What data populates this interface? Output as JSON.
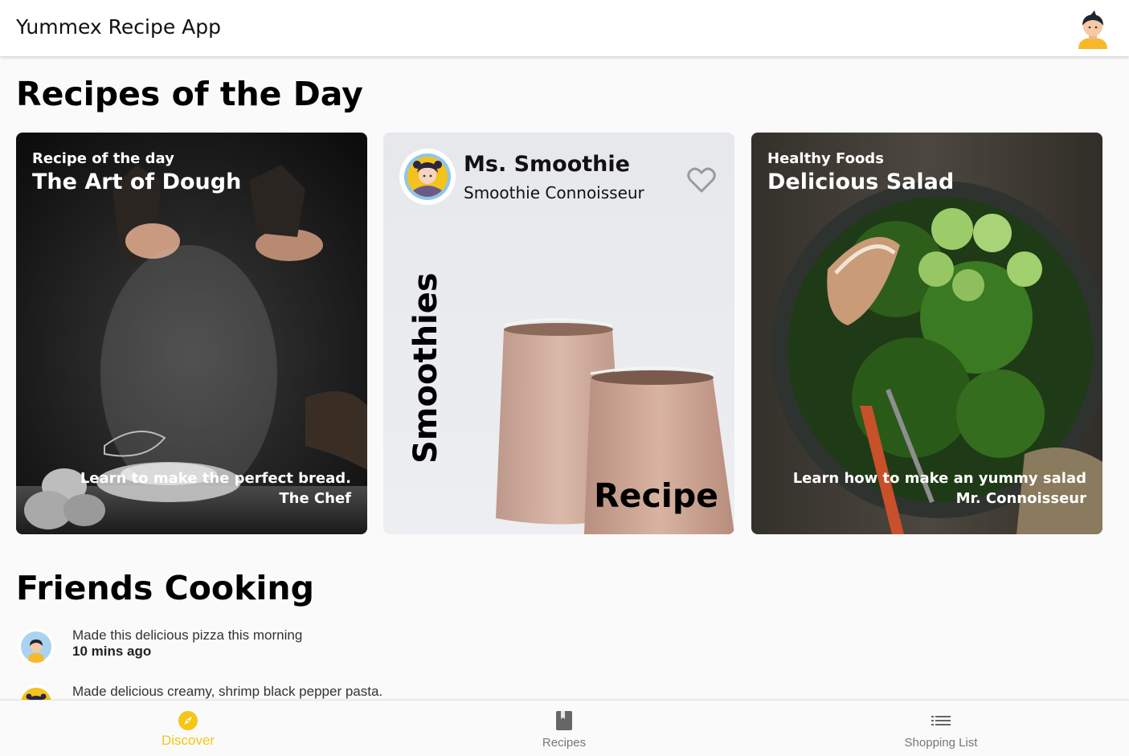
{
  "app": {
    "title": "Yummex Recipe App"
  },
  "sections": {
    "recipes_title": "Recipes of the Day",
    "friends_title": "Friends Cooking"
  },
  "cards": [
    {
      "subtitle": "Recipe of the day",
      "title": "The Art of Dough",
      "description": "Learn to make the perfect bread.",
      "author": "The Chef"
    },
    {
      "chef_name": "Ms. Smoothie",
      "chef_role": "Smoothie Connoisseur",
      "vertical_label": "Smoothies",
      "corner_label": "Recipe",
      "favorited": false
    },
    {
      "subtitle": "Healthy Foods",
      "title": "Delicious Salad",
      "description": "Learn how to make an yummy salad",
      "author": "Mr. Connoisseur"
    }
  ],
  "friends": [
    {
      "text": "Made this delicious pizza this morning",
      "time": "10 mins ago"
    },
    {
      "text": "Made delicious creamy, shrimp black pepper pasta.",
      "time": ""
    }
  ],
  "nav": [
    {
      "label": "Discover",
      "icon": "compass-icon",
      "active": true
    },
    {
      "label": "Recipes",
      "icon": "book-icon",
      "active": false
    },
    {
      "label": "Shopping List",
      "icon": "list-icon",
      "active": false
    }
  ],
  "colors": {
    "accent": "#f5c518",
    "inactive": "#777777",
    "appbar": "#ffffff",
    "background": "#fafafa"
  }
}
